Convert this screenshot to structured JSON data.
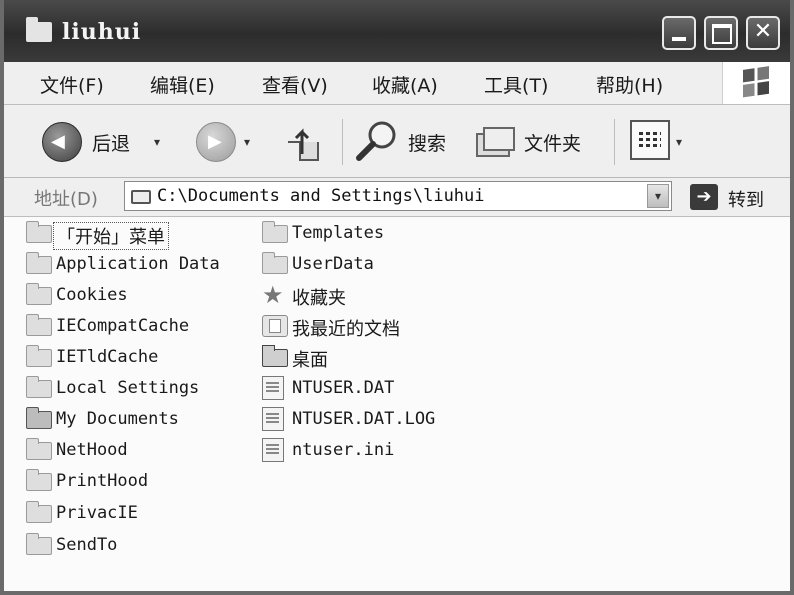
{
  "window": {
    "title": "liuhui",
    "minimize_label": "",
    "maximize_label": "",
    "close_label": "✕"
  },
  "menu": [
    "文件(F)",
    "编辑(E)",
    "查看(V)",
    "收藏(A)",
    "工具(T)",
    "帮助(H)"
  ],
  "toolbar": {
    "back_label": "后退",
    "dropdown_glyph": "▾",
    "back_arrow": "◀",
    "forward_arrow": "▶",
    "search_label": "搜索",
    "folders_label": "文件夹"
  },
  "address": {
    "label": "地址(D)",
    "path": "C:\\Documents and Settings\\liuhui",
    "dropdown_glyph": "▾",
    "go_glyph": "➔",
    "go_label": "转到"
  },
  "files": {
    "column1": [
      {
        "name": "「开始」菜单",
        "icon": "folder-icon",
        "cjk": true,
        "selected": true
      },
      {
        "name": "Application Data",
        "icon": "folder-icon"
      },
      {
        "name": "Cookies",
        "icon": "folder-icon"
      },
      {
        "name": "IECompatCache",
        "icon": "folder-icon"
      },
      {
        "name": "IETldCache",
        "icon": "folder-icon"
      },
      {
        "name": "Local Settings",
        "icon": "folder-icon"
      },
      {
        "name": "My Documents",
        "icon": "folder-icon",
        "dark": true
      },
      {
        "name": "NetHood",
        "icon": "folder-icon"
      },
      {
        "name": "PrintHood",
        "icon": "folder-icon"
      },
      {
        "name": "PrivacIE",
        "icon": "folder-icon"
      },
      {
        "name": "SendTo",
        "icon": "folder-icon"
      }
    ],
    "column2": [
      {
        "name": "Templates",
        "icon": "folder-icon"
      },
      {
        "name": "UserData",
        "icon": "folder-icon"
      },
      {
        "name": "收藏夹",
        "icon": "star-icon",
        "cjk": true
      },
      {
        "name": "我最近的文档",
        "icon": "recent-docs-icon",
        "cjk": true
      },
      {
        "name": "桌面",
        "icon": "desktop-folder-icon",
        "cjk": true
      },
      {
        "name": "NTUSER.DAT",
        "icon": "data-file-icon"
      },
      {
        "name": "NTUSER.DAT.LOG",
        "icon": "text-file-icon"
      },
      {
        "name": "ntuser.ini",
        "icon": "ini-file-icon"
      }
    ]
  }
}
